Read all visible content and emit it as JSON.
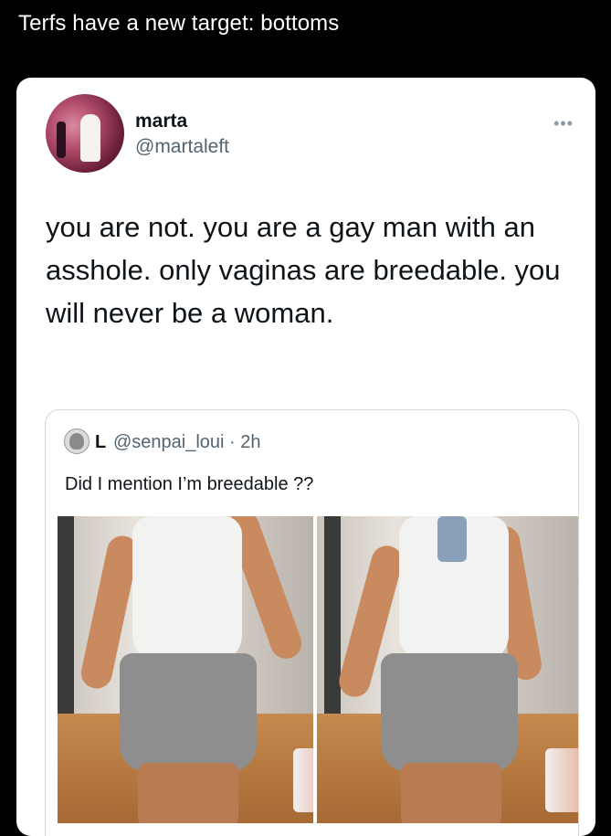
{
  "caption": "Terfs have a new target: bottoms",
  "tweet": {
    "display_name": "marta",
    "handle": "@martaleft",
    "text": "you are not. you are a gay man with an asshole. only vaginas are breedable. you will never be a woman.",
    "more_icon": "more-dots-icon"
  },
  "quoted_tweet": {
    "display_name": "L",
    "handle_time": "@senpai_loui · 2h",
    "text": "Did I mention I’m breedable ??"
  },
  "colors": {
    "background": "#000000",
    "card": "#ffffff",
    "text": "#0f1419",
    "secondary": "#536471",
    "border": "#cfd9de"
  }
}
